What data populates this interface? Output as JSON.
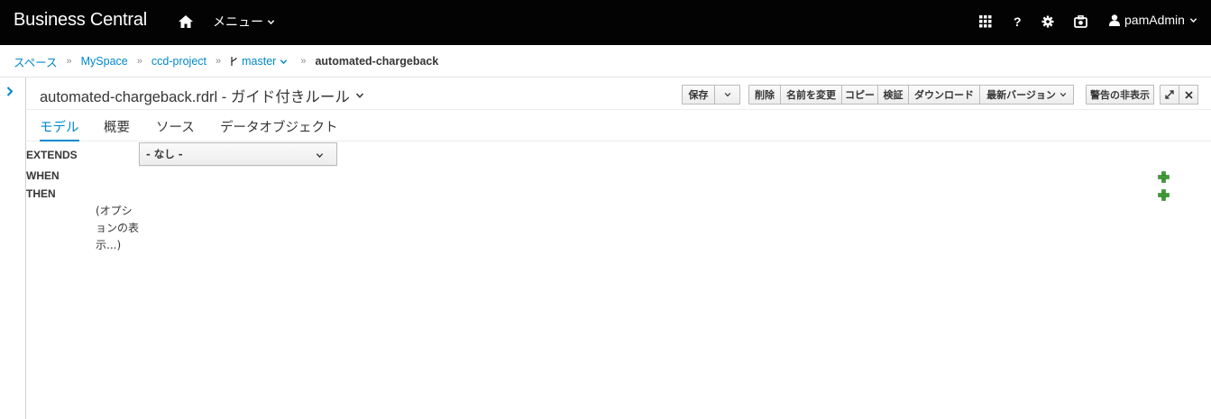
{
  "navbar": {
    "brand": "Business Central",
    "menu_label": "メニュー",
    "help_label": "?",
    "user_name": "pamAdmin"
  },
  "breadcrumb": {
    "items": [
      "スペース",
      "MySpace",
      "ccd-project"
    ],
    "branch": "master",
    "current": "automated-chargeback"
  },
  "editor": {
    "title": "automated-chargeback.rdrl - ガイド付きルール",
    "toolbar": {
      "save": "保存",
      "delete": "削除",
      "rename": "名前を変更",
      "copy": "コピー",
      "validate": "検証",
      "download": "ダウンロード",
      "latest_version": "最新バージョン",
      "hide_warnings": "警告の非表示"
    },
    "tabs": [
      "モデル",
      "概要",
      "ソース",
      "データオブジェクト"
    ],
    "active_tab": "モデル",
    "extends_label": "EXTENDS",
    "extends_value": "- なし -",
    "when_label": "WHEN",
    "then_label": "THEN",
    "options_text": [
      "(オプシ",
      "ョンの表",
      "示...)"
    ]
  },
  "colors": {
    "navbar_bg": "#030303",
    "link": "#0088ce",
    "plus_green": "#3f9c35"
  }
}
